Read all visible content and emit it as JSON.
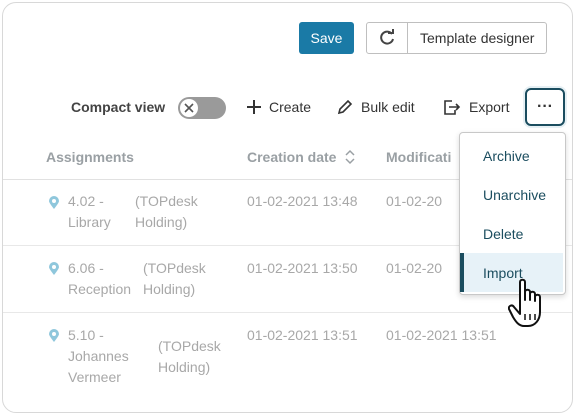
{
  "toolbar": {
    "save_label": "Save",
    "template_designer_label": "Template designer",
    "compact_view_label": "Compact view",
    "compact_view_on": false,
    "create_label": "Create",
    "bulk_edit_label": "Bulk edit",
    "export_label": "Export",
    "more_label": "···"
  },
  "table": {
    "columns": [
      "Assignments",
      "Creation date",
      "Modificati"
    ],
    "rows": [
      {
        "assignment": [
          "4.02 -",
          "Library"
        ],
        "org": [
          "(TOPdesk",
          "Holding)"
        ],
        "created": "01-02-2021 13:48",
        "modified": "01-02-20"
      },
      {
        "assignment": [
          "6.06 -",
          "Reception"
        ],
        "org": [
          "(TOPdesk",
          "Holding)"
        ],
        "created": "01-02-2021 13:50",
        "modified": "01-02-20"
      },
      {
        "assignment": [
          "5.10 -",
          "Johannes",
          "Vermeer"
        ],
        "org": [
          "(TOPdesk",
          "Holding)"
        ],
        "created": "01-02-2021 13:51",
        "modified": "01-02-2021 13:51"
      }
    ]
  },
  "menu": {
    "items": [
      "Archive",
      "Unarchive",
      "Delete",
      "Import"
    ],
    "active_index": 3
  },
  "colors": {
    "primary": "#1a7aa6",
    "dark_teal": "#1b4d5f",
    "pin": "#8fc7dc"
  }
}
